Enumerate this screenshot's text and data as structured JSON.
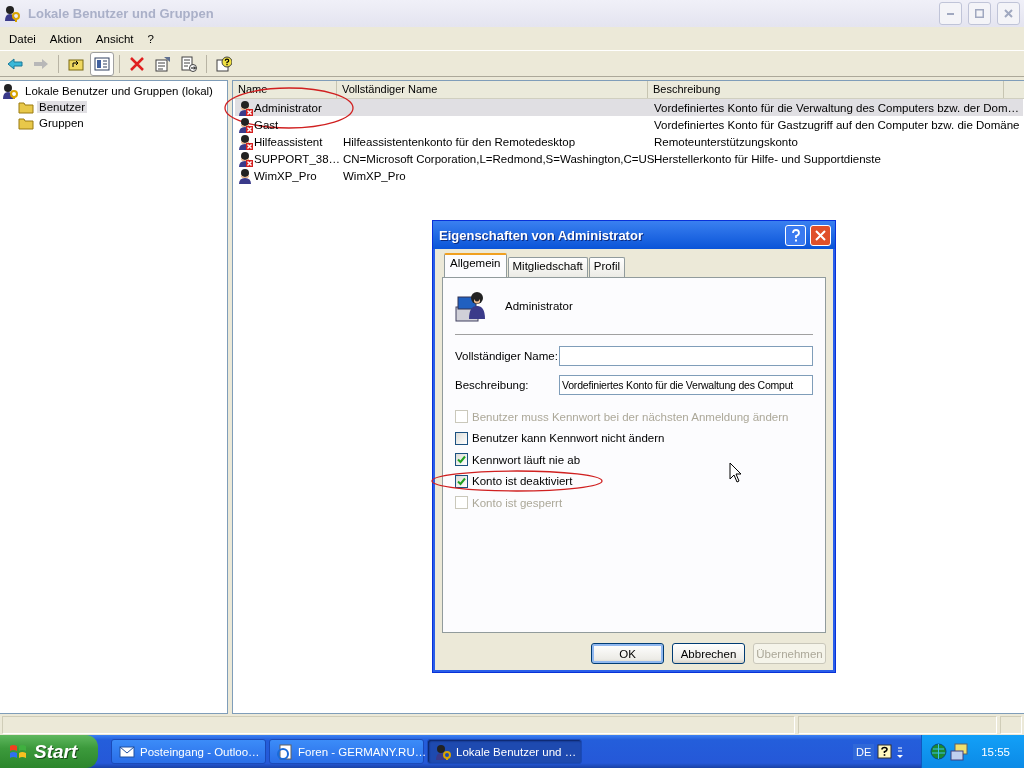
{
  "window": {
    "title": "Lokale Benutzer und Gruppen",
    "active": false
  },
  "menu": [
    "Datei",
    "Aktion",
    "Ansicht",
    "?"
  ],
  "tree": {
    "label": "Lokale Benutzer und Gruppen (lokal)",
    "children": [
      {
        "label": "Benutzer",
        "selected": true
      },
      {
        "label": "Gruppen",
        "selected": false
      }
    ]
  },
  "table": {
    "columns": [
      "Name",
      "Vollständiger Name",
      "Beschreibung"
    ],
    "rows": [
      {
        "name": "Administrator",
        "description": "Vordefiniertes Konto für die Verwaltung des Computers bzw. der Dom…",
        "disabled": true,
        "selected": true,
        "circled": true
      },
      {
        "name": "Gast",
        "description": "Vordefiniertes Konto für Gastzugriff auf den Computer bzw. die Domäne",
        "disabled": true,
        "selected": false,
        "circled": false
      },
      {
        "name": "Hilfeassistent",
        "full_name": "Hilfeassistentenkonto für den Remotedesktop",
        "description": "Remoteunterstützungskonto",
        "disabled": true,
        "selected": false,
        "circled": false
      },
      {
        "name": "SUPPORT_38…",
        "full_name": "CN=Microsoft Corporation,L=Redmond,S=Washington,C=US",
        "description": "Herstellerkonto für Hilfe- und Supportdienste",
        "disabled": true,
        "selected": false,
        "circled": false
      },
      {
        "name": "WimXP_Pro",
        "full_name": "WimXP_Pro",
        "disabled": false,
        "selected": false,
        "circled": false
      }
    ]
  },
  "dialog": {
    "title": "Eigenschaften von Administrator",
    "tabs": [
      {
        "label": "Allgemein",
        "selected": true
      },
      {
        "label": "Mitgliedschaft",
        "selected": false
      },
      {
        "label": "Profil",
        "selected": false
      }
    ],
    "user_name": "Administrator",
    "fields": [
      {
        "label": "Vollständiger Name:"
      },
      {
        "label": "Beschreibung:",
        "value": "Vordefiniertes Konto für die Verwaltung des Comput"
      }
    ],
    "checkboxes": [
      {
        "label": "Benutzer muss Kennwort bei der nächsten Anmeldung ändern",
        "checked": false,
        "disabled": true,
        "circled": false
      },
      {
        "label": "Benutzer kann Kennwort nicht ändern",
        "checked": false,
        "disabled": false,
        "circled": false
      },
      {
        "label": "Kennwort läuft nie ab",
        "checked": true,
        "disabled": false,
        "circled": false
      },
      {
        "label": "Konto ist deaktiviert",
        "checked": true,
        "disabled": false,
        "circled": true
      },
      {
        "label": "Konto ist gesperrt",
        "checked": false,
        "disabled": true,
        "circled": false
      }
    ],
    "buttons": [
      {
        "label": "OK",
        "disabled": false,
        "default": true
      },
      {
        "label": "Abbrechen",
        "disabled": false,
        "default": false
      },
      {
        "label": "Übernehmen",
        "disabled": true,
        "default": false
      }
    ]
  },
  "taskbar": {
    "start": "Start",
    "tasks": [
      {
        "label": "Posteingang - Outloo…",
        "kind": "mail",
        "selected": false
      },
      {
        "label": "Foren - GERMANY.RU…",
        "kind": "browser",
        "selected": false
      },
      {
        "label": "Lokale Benutzer und …",
        "kind": "users",
        "selected": true
      }
    ],
    "language": "DE",
    "clock": "15:55"
  }
}
